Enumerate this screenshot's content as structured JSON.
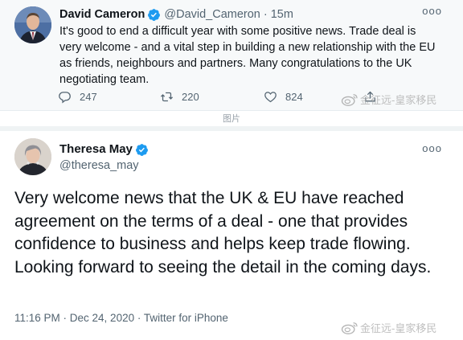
{
  "tweet1": {
    "author_name": "David Cameron",
    "handle": "@David_Cameron",
    "separator": "·",
    "time": "15m",
    "more": "ooo",
    "text": "It's good to end a difficult year with some positive news. Trade deal is very welcome - and a vital step in building a new relationship with the EU as friends, neighbours and partners. Many congratulations to the UK negotiating team.",
    "actions": {
      "reply_count": "247",
      "retweet_count": "220",
      "like_count": "824"
    }
  },
  "watermark": {
    "text": "金征远-皇家移民"
  },
  "caption": "图片",
  "tweet2": {
    "author_name": "Theresa May",
    "handle": "@theresa_may",
    "more": "ooo",
    "text": "Very welcome news that the UK & EU have reached agreement on the terms of a deal - one that provides confidence to business and helps keep trade flowing. Looking forward to seeing the detail in the coming days.",
    "meta": "11:16 PM · Dec 24, 2020 · Twitter for iPhone"
  },
  "colors": {
    "verified": "#1d9bf0",
    "secondary_text": "#536471",
    "primary_text": "#0f1419"
  },
  "icons": [
    "verified-badge-icon",
    "reply-icon",
    "retweet-icon",
    "like-icon",
    "share-icon",
    "more-icon",
    "weibo-icon"
  ]
}
